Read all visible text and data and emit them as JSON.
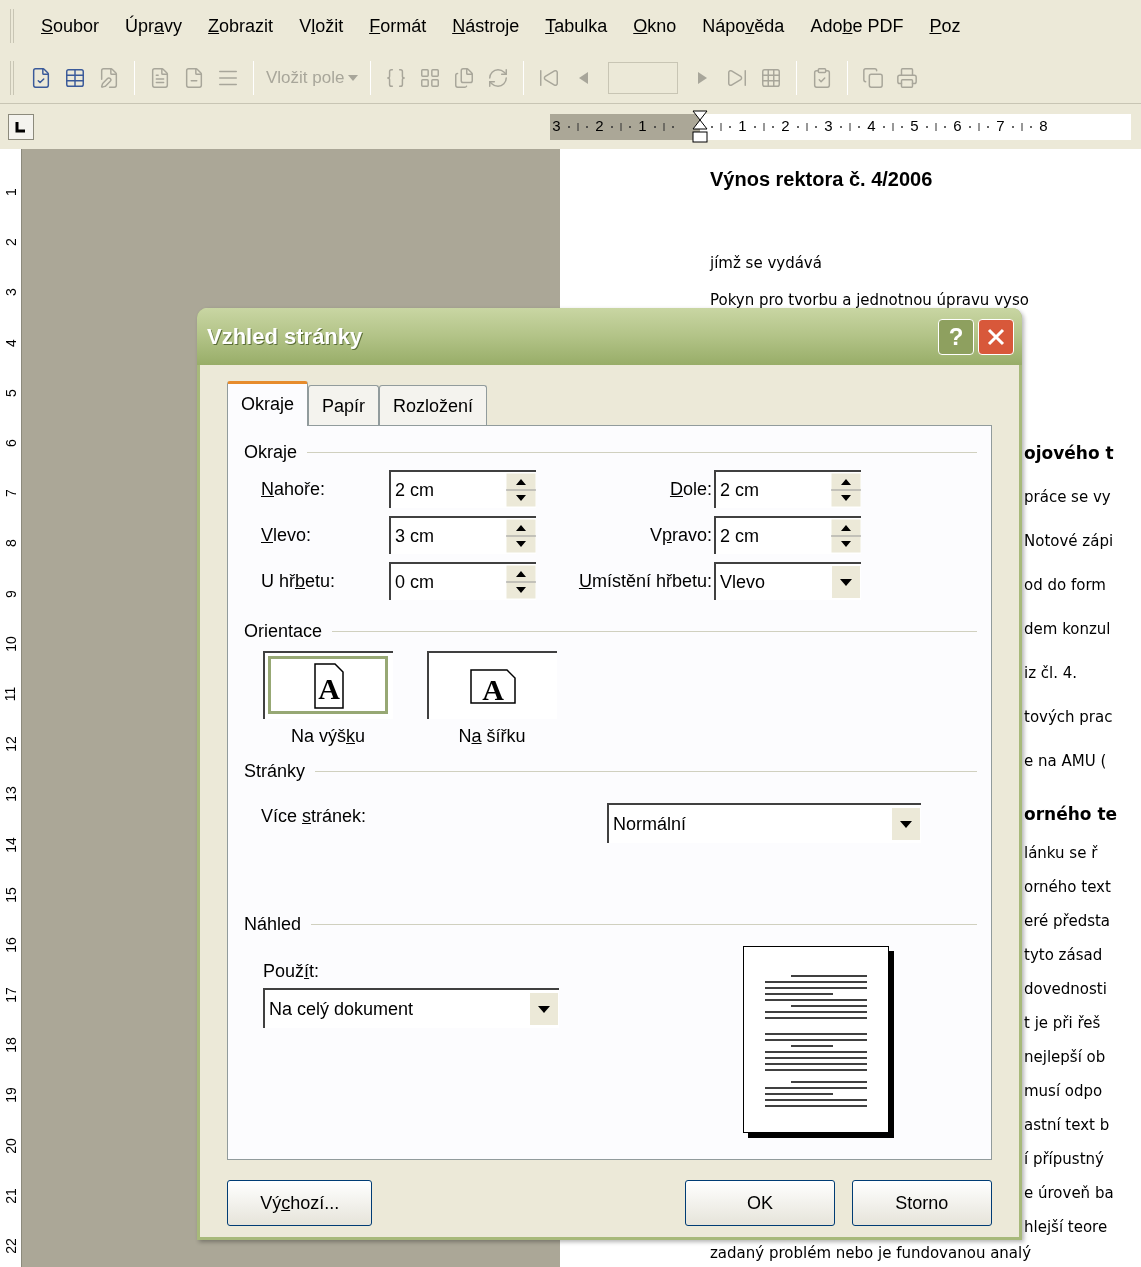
{
  "menu": [
    {
      "key": "S",
      "post": "oubor"
    },
    {
      "pre": "Úpr",
      "key": "a",
      "post": "vy"
    },
    {
      "key": "Z",
      "post": "obrazit"
    },
    {
      "pre": "V",
      "key": "l",
      "post": "ožit"
    },
    {
      "key": "F",
      "post": "ormát"
    },
    {
      "key": "N",
      "post": "ástroje"
    },
    {
      "key": "T",
      "post": "abulka"
    },
    {
      "key": "O",
      "post": "kno"
    },
    {
      "pre": "Nápo",
      "key": "v",
      "post": "ěda"
    },
    {
      "pre": "Ado",
      "key": "b",
      "post": "e PDF"
    },
    {
      "key": "P",
      "post": "oz"
    }
  ],
  "toolbar": {
    "insert_field": {
      "label": "Vložit pole",
      "disabled": true
    }
  },
  "rulers": {
    "horizontal": {
      "before": [
        "3",
        "2",
        "1"
      ],
      "after": [
        "1",
        "2",
        "3",
        "4",
        "5",
        "6",
        "7",
        "8"
      ]
    },
    "vertical": [
      "1",
      "2",
      "3",
      "4",
      "5",
      "6",
      "7",
      "8",
      "9",
      "10",
      "11",
      "12",
      "13",
      "14",
      "15",
      "16",
      "17",
      "18",
      "19",
      "20",
      "21",
      "22"
    ]
  },
  "document": {
    "title": "Výnos rektora č. 4/2006",
    "lines": [
      "jímž se vydává",
      "Pokyn pro tvorbu a jednotnou úpravu vyso"
    ],
    "sections": [
      {
        "heading": "ojového t",
        "lines": [
          "práce se vy",
          "Notové zápi",
          "od do form",
          "dem konzul",
          "iz čl. 4.",
          "tových prac",
          "e na AMU ("
        ]
      },
      {
        "heading": "orného te",
        "lines": [
          "lánku se ř",
          "orného text",
          "eré předsta",
          "tyto zásad",
          "dovednosti",
          "t je při řeš",
          "nejlepší ob",
          "musí odpo",
          "astní text b",
          "í přípustný",
          "e úroveň ba",
          "hlejší teore"
        ]
      }
    ],
    "last_line": "zadaný problém nebo je fundovanou analý"
  },
  "dialog": {
    "title": "Vzhled stránky",
    "help_button": "?",
    "tabs": [
      {
        "label": {
          "pre": "Okraje"
        },
        "selected": true
      },
      {
        "label": {
          "pre": "Papír"
        },
        "selected": false
      },
      {
        "label": {
          "pre": "Rozložení"
        },
        "selected": false
      }
    ],
    "margins": {
      "title": "Okraje",
      "rows": [
        {
          "left": {
            "label": {
              "key": "N",
              "post": "ahoře:"
            },
            "value": "2 cm",
            "kind": "spin"
          },
          "right": {
            "label": {
              "key": "D",
              "post": "ole:"
            },
            "value": "2 cm",
            "kind": "spin"
          }
        },
        {
          "left": {
            "label": {
              "key": "V",
              "post": "levo:"
            },
            "value": "3 cm",
            "kind": "spin"
          },
          "right": {
            "label": {
              "pre": "V",
              "key": "p",
              "post": "ravo:"
            },
            "value": "2 cm",
            "kind": "spin"
          }
        },
        {
          "left": {
            "label": {
              "pre": "U hř",
              "key": "b",
              "post": "etu:"
            },
            "value": "0 cm",
            "kind": "spin"
          },
          "right": {
            "label": {
              "key": "U",
              "post": "místění hřbetu:"
            },
            "value": "Vlevo",
            "kind": "select"
          }
        }
      ]
    },
    "orientation": {
      "title": "Orientace",
      "options": [
        {
          "label": {
            "pre": "Na výš",
            "key": "k",
            "post": "u"
          },
          "glyph": "A",
          "kind": "portrait",
          "selected": true
        },
        {
          "label": {
            "pre": "N",
            "key": "a",
            "post": " šířku"
          },
          "glyph": "A",
          "kind": "landscape",
          "selected": false
        }
      ]
    },
    "pages": {
      "title": "Stránky",
      "label": {
        "pre": "Více ",
        "key": "s",
        "post": "tránek:"
      },
      "value": "Normální"
    },
    "preview": {
      "title": "Náhled",
      "apply_label": {
        "pre": "Použ",
        "key": "í",
        "post": "t:"
      },
      "apply_value": "Na celý dokument"
    },
    "buttons": [
      {
        "label": {
          "pre": "Vý",
          "key": "c",
          "post": "hozí..."
        }
      },
      {
        "label": {
          "pre": "OK"
        }
      },
      {
        "label": {
          "pre": "Storno"
        }
      }
    ]
  }
}
